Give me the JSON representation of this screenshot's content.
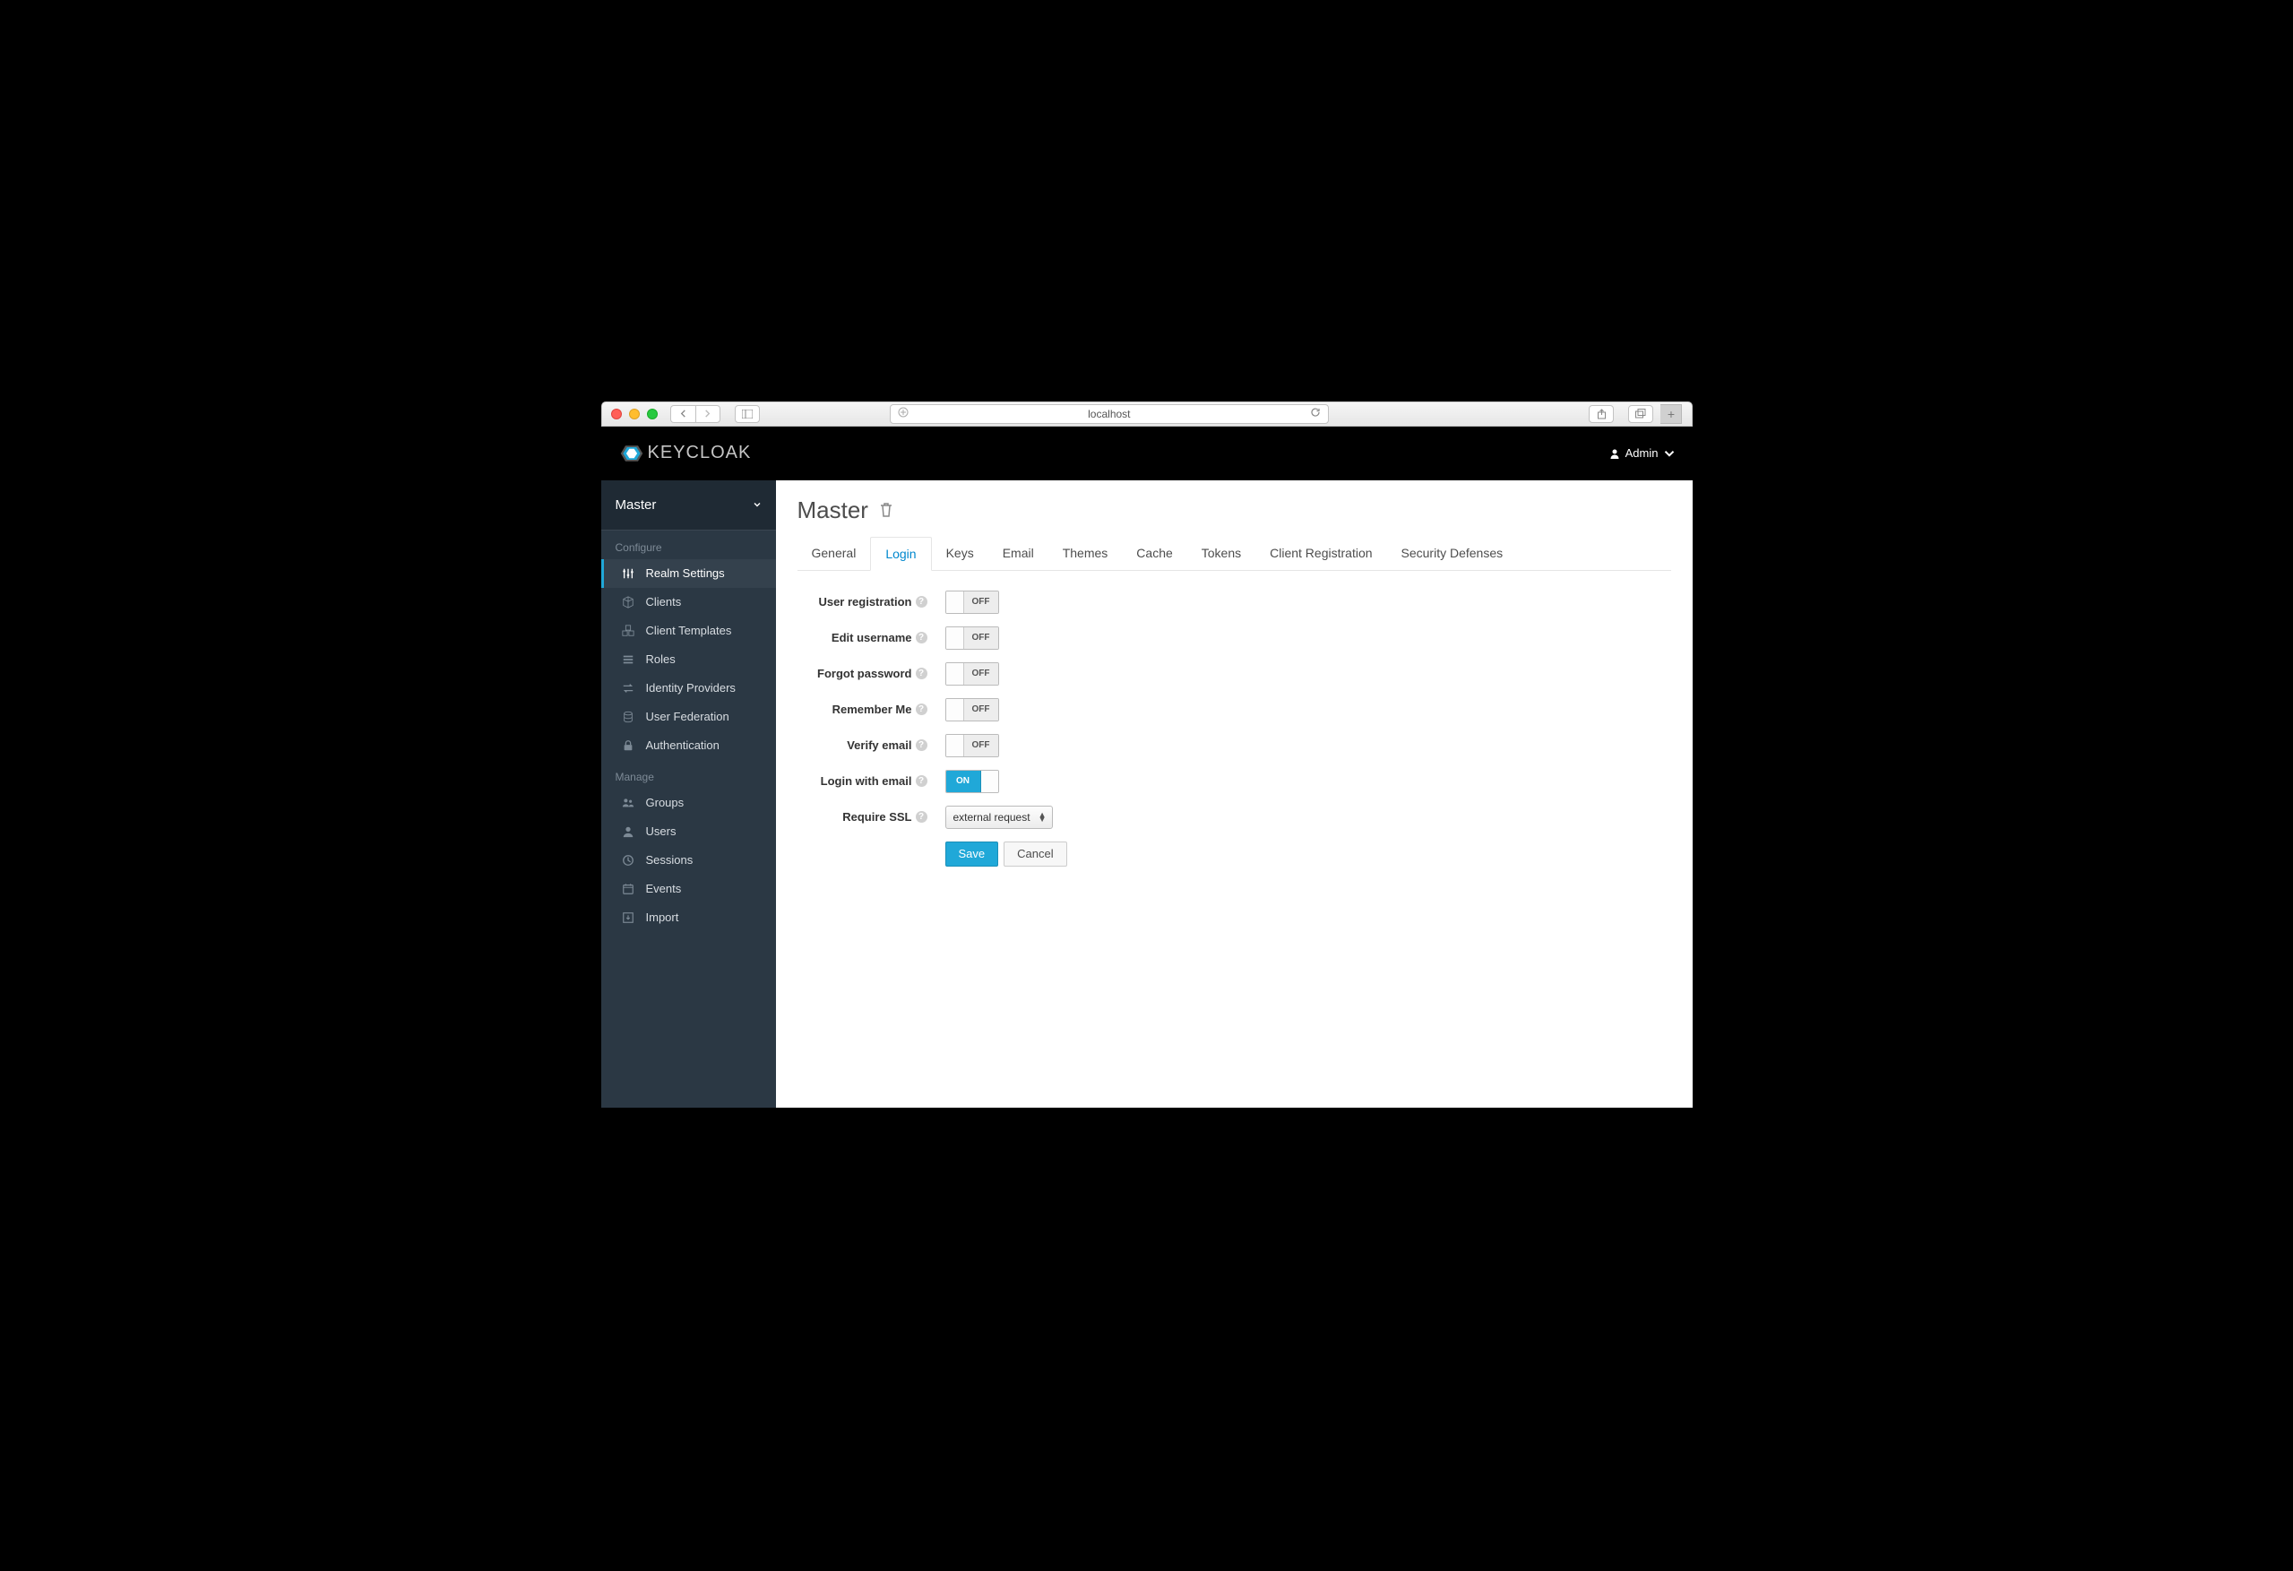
{
  "browser": {
    "host": "localhost"
  },
  "header": {
    "brand": "KEYCLOAK",
    "user": "Admin"
  },
  "sidebar": {
    "realm": "Master",
    "sections": {
      "configure": {
        "label": "Configure",
        "items": [
          {
            "label": "Realm Settings",
            "active": true
          },
          {
            "label": "Clients"
          },
          {
            "label": "Client Templates"
          },
          {
            "label": "Roles"
          },
          {
            "label": "Identity Providers"
          },
          {
            "label": "User Federation"
          },
          {
            "label": "Authentication"
          }
        ]
      },
      "manage": {
        "label": "Manage",
        "items": [
          {
            "label": "Groups"
          },
          {
            "label": "Users"
          },
          {
            "label": "Sessions"
          },
          {
            "label": "Events"
          },
          {
            "label": "Import"
          }
        ]
      }
    }
  },
  "page": {
    "title": "Master",
    "tabs": [
      {
        "label": "General"
      },
      {
        "label": "Login",
        "active": true
      },
      {
        "label": "Keys"
      },
      {
        "label": "Email"
      },
      {
        "label": "Themes"
      },
      {
        "label": "Cache"
      },
      {
        "label": "Tokens"
      },
      {
        "label": "Client Registration"
      },
      {
        "label": "Security Defenses"
      }
    ],
    "form": {
      "rows": [
        {
          "label": "User registration",
          "value": "OFF"
        },
        {
          "label": "Edit username",
          "value": "OFF"
        },
        {
          "label": "Forgot password",
          "value": "OFF"
        },
        {
          "label": "Remember Me",
          "value": "OFF"
        },
        {
          "label": "Verify email",
          "value": "OFF"
        },
        {
          "label": "Login with email",
          "value": "ON"
        }
      ],
      "require_ssl": {
        "label": "Require SSL",
        "value": "external request"
      },
      "buttons": {
        "save": "Save",
        "cancel": "Cancel"
      }
    }
  }
}
